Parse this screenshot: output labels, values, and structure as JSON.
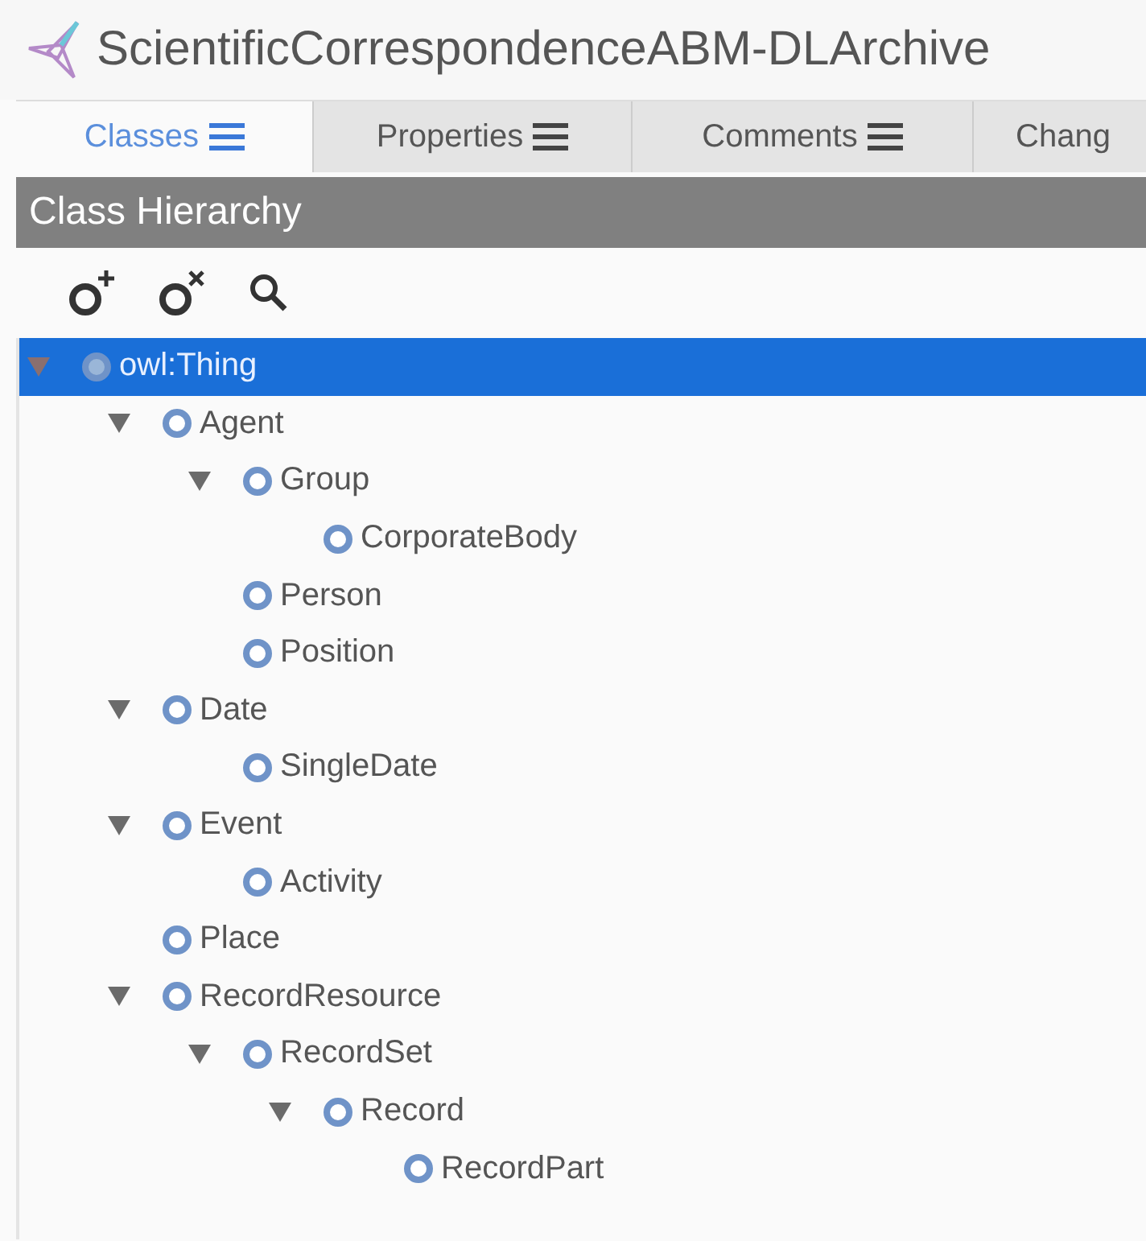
{
  "window": {
    "title": "ScientificCorrespondenceABM-DLArchive"
  },
  "tabs": [
    {
      "label": "Classes",
      "selected": true
    },
    {
      "label": "Properties",
      "selected": false
    },
    {
      "label": "Comments",
      "selected": false
    },
    {
      "label": "Chang",
      "selected": false
    }
  ],
  "panel": {
    "title": "Class Hierarchy"
  },
  "tree": [
    {
      "label": "owl:Thing",
      "selected": true,
      "expanded": true,
      "children": [
        {
          "label": "Agent",
          "selected": false,
          "expanded": true,
          "children": [
            {
              "label": "Group",
              "selected": false,
              "expanded": true,
              "children": [
                {
                  "label": "CorporateBody",
                  "selected": false,
                  "expanded": false
                }
              ]
            },
            {
              "label": "Person",
              "selected": false,
              "expanded": false
            },
            {
              "label": "Position",
              "selected": false,
              "expanded": false
            }
          ]
        },
        {
          "label": "Date",
          "selected": false,
          "expanded": true,
          "children": [
            {
              "label": "SingleDate",
              "selected": false,
              "expanded": false
            }
          ]
        },
        {
          "label": "Event",
          "selected": false,
          "expanded": true,
          "children": [
            {
              "label": "Activity",
              "selected": false,
              "expanded": false
            }
          ]
        },
        {
          "label": "Place",
          "selected": false,
          "expanded": false
        },
        {
          "label": "RecordResource",
          "selected": false,
          "expanded": true,
          "children": [
            {
              "label": "RecordSet",
              "selected": false,
              "expanded": true,
              "children": [
                {
                  "label": "Record",
                  "selected": false,
                  "expanded": true,
                  "children": [
                    {
                      "label": "RecordPart",
                      "selected": false,
                      "expanded": false
                    }
                  ]
                }
              ]
            }
          ]
        }
      ]
    }
  ]
}
